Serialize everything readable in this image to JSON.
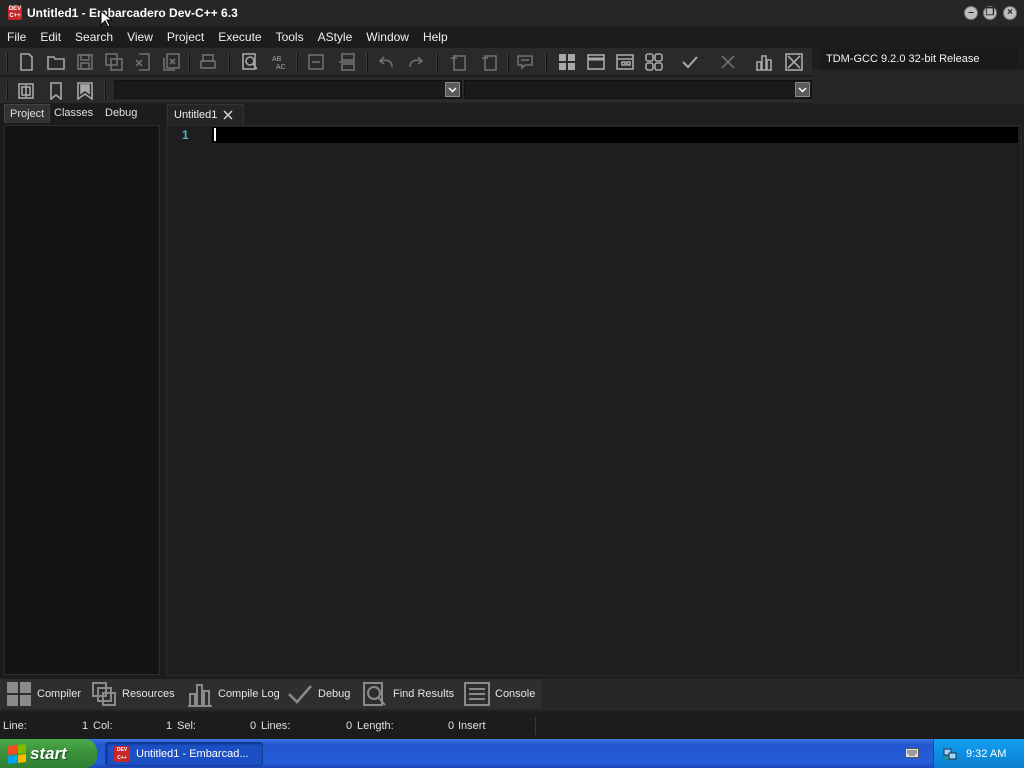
{
  "window": {
    "title": "Untitled1 - Embarcadero Dev-C++ 6.3",
    "icon_text": "DEV C++"
  },
  "menu": [
    "File",
    "Edit",
    "Search",
    "View",
    "Project",
    "Execute",
    "Tools",
    "AStyle",
    "Window",
    "Help"
  ],
  "toolbar": {
    "compiler_select": "TDM-GCC 9.2.0 32-bit Release"
  },
  "sidebar": {
    "tabs": [
      "Project",
      "Classes",
      "Debug"
    ]
  },
  "editor": {
    "tab_label": "Untitled1",
    "line_number": "1"
  },
  "bottom_panel": {
    "tabs": [
      "Compiler",
      "Resources",
      "Compile Log",
      "Debug",
      "Find Results",
      "Console"
    ]
  },
  "status": {
    "line_label": "Line:",
    "line_value": "1",
    "col_label": "Col:",
    "col_value": "1",
    "sel_label": "Sel:",
    "sel_value": "0",
    "lines_label": "Lines:",
    "lines_value": "0",
    "length_label": "Length:",
    "length_value": "0",
    "mode": "Insert"
  },
  "taskbar": {
    "start_label": "start",
    "task_label": "Untitled1 - Embarcad...",
    "clock": "9:32 AM"
  }
}
